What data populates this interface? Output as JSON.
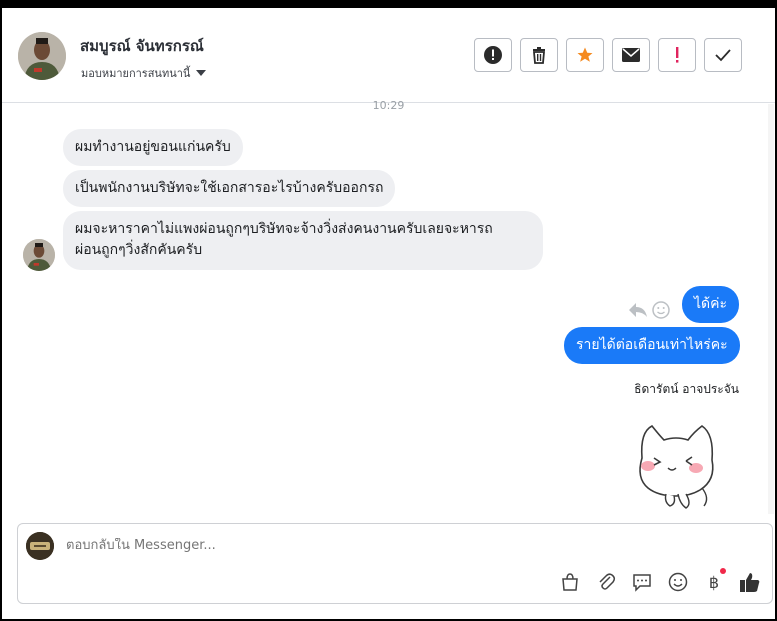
{
  "header": {
    "contact_name": "สมบูรณ์ จันทรกรณ์",
    "assign_label": "มอบหมายการสนทนานี้"
  },
  "toolbar": {
    "icons": [
      "alert-circle-icon",
      "trash-icon",
      "star-icon",
      "envelope-icon",
      "exclamation-icon",
      "check-icon"
    ],
    "star_color": "#f58a1f",
    "exclamation_color": "#e0245e"
  },
  "conversation": {
    "timestamp": "10:29",
    "incoming": [
      "ผมทำงานอยู่ขอนแก่นครับ",
      "เป็นพนักงานบริษัทจะใช้เอกสารอะไรบ้างครับออกรถ",
      "ผมจะหาราคาไม่แพงผ่อนถูกๆบริษัทจะจ้างวิ่งส่งคนงานครับเลยจะหารถ",
      "ผ่อนถูกๆวิ่งสักคันครับ"
    ],
    "outgoing": [
      "ได้ค่ะ",
      "รายได้ต่อเดือนเท่าไหร่คะ"
    ],
    "sender_label": "ธิดารัตน์ อาจประจัน",
    "outgoing_color": "#1a7af8"
  },
  "composer": {
    "placeholder": "ตอบกลับใน Messenger...",
    "icons": [
      "bag-icon",
      "paperclip-icon",
      "chat-bubble-icon",
      "emoji-icon",
      "baht-icon",
      "thumbs-up-icon"
    ],
    "baht_symbol": "฿"
  }
}
